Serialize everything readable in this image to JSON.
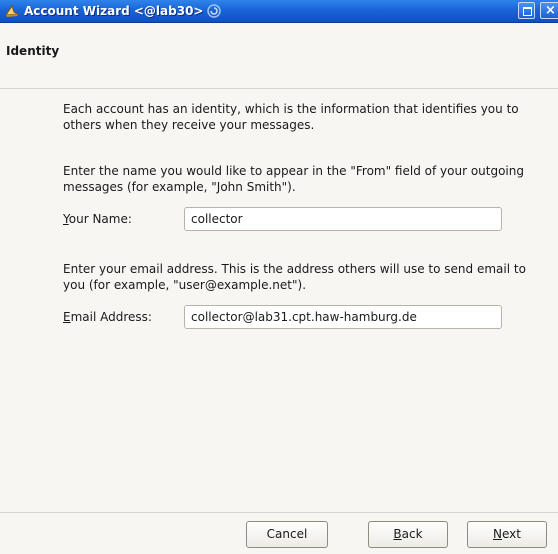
{
  "window": {
    "title": "Account Wizard <@lab30>",
    "icons": {
      "app": "wizard-hat-icon",
      "swirl": "swirl-icon",
      "maximize": "maximize-icon",
      "close": "close-icon"
    },
    "accent": "#1a64d8"
  },
  "page": {
    "title": "Identity",
    "intro": "Each account has an identity, which is the information that identifies you to others when they receive your messages."
  },
  "name_section": {
    "description": "Enter the name you would like to appear in the \"From\" field of your outgoing messages (for example, \"John Smith\").",
    "label_accel": "Y",
    "label_rest": "our Name:",
    "value": "collector"
  },
  "email_section": {
    "description": "Enter your email address. This is the address others will use to send email to you (for example, \"user@example.net\").",
    "label_accel": "E",
    "label_rest": "mail Address:",
    "value": "collector@lab31.cpt.haw-hamburg.de"
  },
  "buttons": {
    "cancel": "Cancel",
    "back_accel": "B",
    "back_rest": "ack",
    "next_accel": "N",
    "next_rest": "ext"
  }
}
